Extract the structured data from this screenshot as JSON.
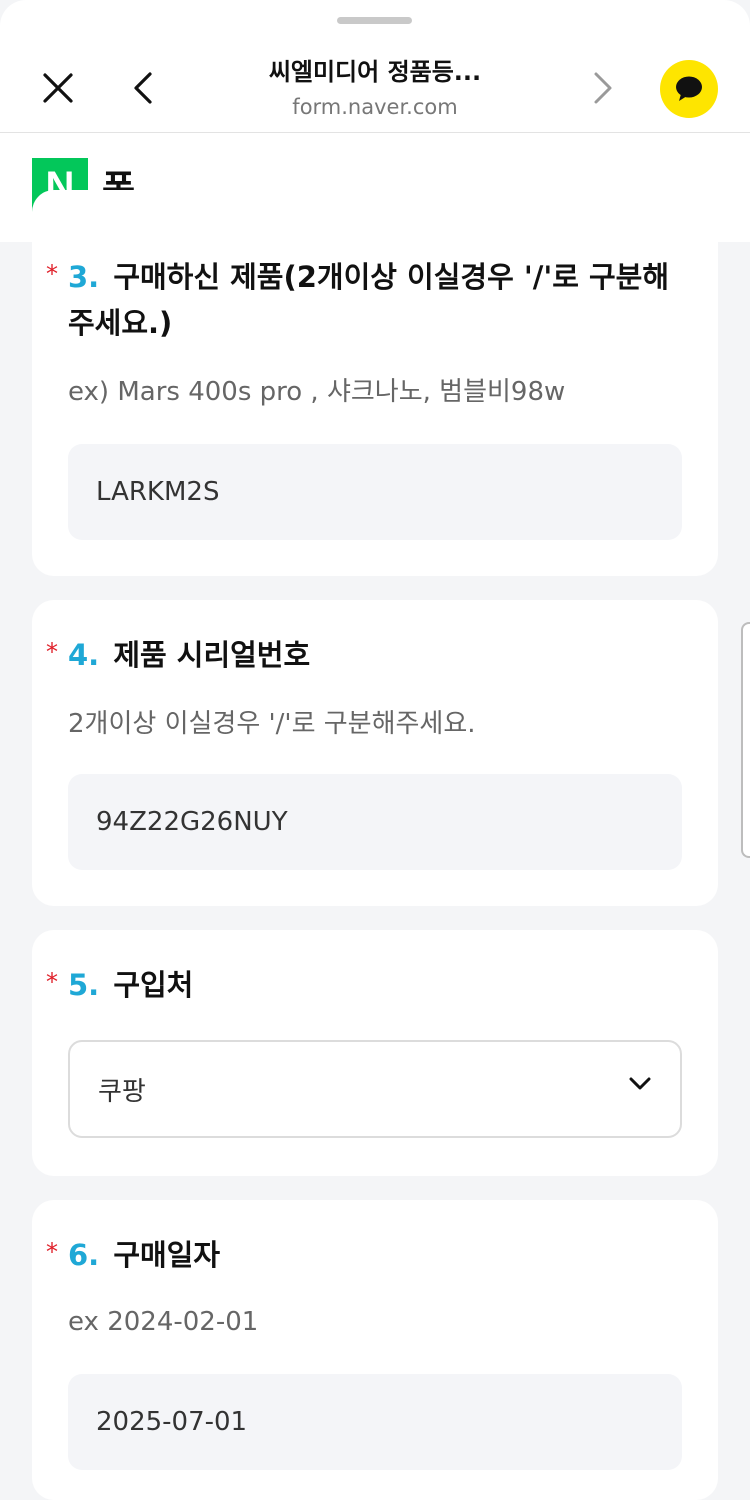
{
  "header": {
    "title": "씨엘미디어 정품등...",
    "url": "form.naver.com"
  },
  "brand": {
    "logo_letter": "N",
    "name": "폼"
  },
  "questions": [
    {
      "required_mark": "*",
      "number": "3.",
      "title_line1": "구매하신 제품(2개이상 이실경우 '/'로 구분해",
      "title_line2": "주세요.)",
      "description": "ex) Mars 400s pro , 샤크나노, 범블비98w",
      "value": "LARKM2S"
    },
    {
      "required_mark": "*",
      "number": "4.",
      "title": "제품 시리얼번호",
      "description": "2개이상 이실경우 '/'로 구분해주세요.",
      "value": "94Z22G26NUY"
    },
    {
      "required_mark": "*",
      "number": "5.",
      "title": "구입처",
      "selected": "쿠팡"
    },
    {
      "required_mark": "*",
      "number": "6.",
      "title": "구매일자",
      "description": "ex 2024-02-01",
      "value": "2025-07-01"
    }
  ],
  "colors": {
    "accent": "#1fa8d6",
    "required": "#e0202a",
    "naver_green": "#03c75a",
    "kakao_yellow": "#fee500"
  }
}
